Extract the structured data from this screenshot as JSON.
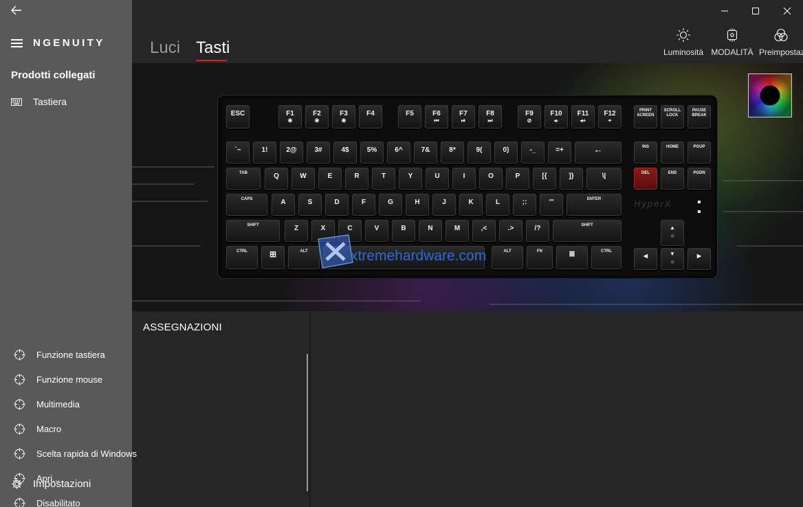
{
  "sidebar": {
    "brand": "NGENUITY",
    "section_title": "Prodotti collegati",
    "items": [
      {
        "label": "Tastiera",
        "icon": "keyboard-icon"
      }
    ],
    "settings_label": "Impostazioni"
  },
  "tabs": [
    {
      "label": "Luci",
      "active": false
    },
    {
      "label": "Tasti",
      "active": true
    }
  ],
  "tools": [
    {
      "label": "Luminosità",
      "icon": "sun-icon"
    },
    {
      "label": "MODALITÀ GIOCO",
      "icon": "game-mode-icon"
    },
    {
      "label": "Preimpostazioni",
      "icon": "presets-icon"
    }
  ],
  "accent_color": "#d91f26",
  "keyboard": {
    "logo": "HyperX",
    "keys": {
      "esc": "ESC",
      "f1": "F1",
      "f2": "F2",
      "f3": "F3",
      "f4": "F4",
      "f5": "F5",
      "f6": "F6",
      "f7": "F7",
      "f8": "F8",
      "f9": "F9",
      "f10": "F10",
      "f11": "F11",
      "f12": "F12",
      "prtsc": "PRINT SCREEN",
      "scrlk": "SCROLL LOCK",
      "pause": "PAUSE BREAK",
      "tilde": "`~",
      "n1": "1!",
      "n2": "2@",
      "n3": "3#",
      "n4": "4$",
      "n5": "5%",
      "n6": "6^",
      "n7": "7&",
      "n8": "8*",
      "n9": "9(",
      "n0": "0)",
      "minus": "-_",
      "equal": "=+",
      "backspace": "←",
      "ins": "INS",
      "home": "HOME",
      "pgup": "PGUP",
      "tab": "TAB",
      "q": "Q",
      "w": "W",
      "e": "E",
      "r": "R",
      "t": "T",
      "y": "Y",
      "u": "U",
      "i": "I",
      "o": "O",
      "p": "P",
      "lbracket": "[{",
      "rbracket": "]}",
      "backslash": "\\|",
      "del": "DEL",
      "end": "END",
      "pgdn": "PGDN",
      "caps": "CAPS",
      "a": "A",
      "s": "S",
      "d": "D",
      "f": "F",
      "g": "G",
      "h": "H",
      "j": "J",
      "k": "K",
      "l": "L",
      "semicolon": ";:",
      "quote": "'\"",
      "enter": "ENTER",
      "lshift": "SHIFT",
      "z": "Z",
      "x": "X",
      "c": "C",
      "v": "V",
      "b": "B",
      "n": "N",
      "m": "M",
      "comma": ",<",
      "period": ".>",
      "slash": "/?",
      "rshift": "SHIFT",
      "up": "▲",
      "lctrl": "CTRL",
      "win": "⊞",
      "lalt": "ALT",
      "space": "",
      "ralt": "ALT",
      "fn": "FN",
      "menu": "≣",
      "rctrl": "CTRL",
      "left": "◀",
      "down": "▼",
      "right": "▶"
    },
    "selected_key": "DEL"
  },
  "watermark": "xtremehardware.com",
  "assignments": {
    "title": "ASSEGNAZIONI",
    "items": [
      "Funzione tastiera",
      "Funzione mouse",
      "Multimedia",
      "Macro",
      "Scelta rapida di Windows",
      "Apri...",
      "Disabilitato"
    ]
  }
}
